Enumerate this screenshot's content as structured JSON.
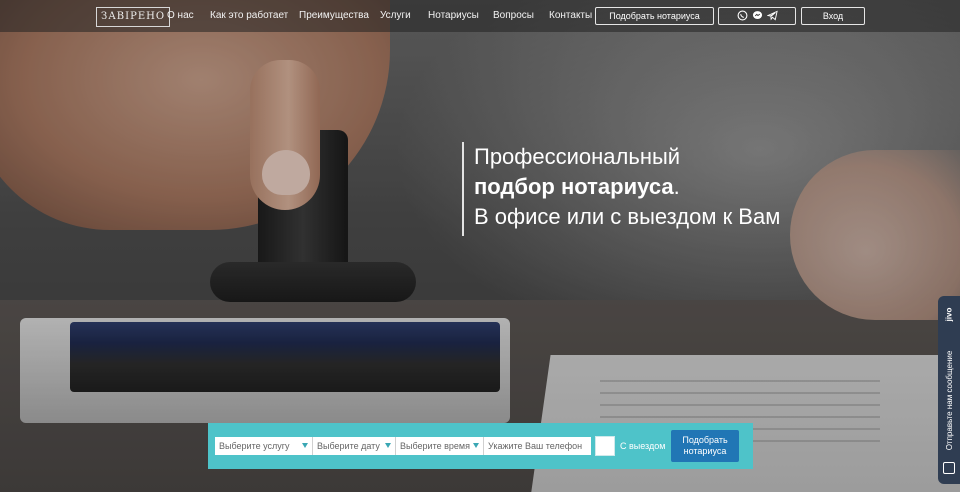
{
  "logo": "ЗАВІРЕНО",
  "nav": {
    "items": [
      {
        "label": "О нас"
      },
      {
        "label": "Как это работает"
      },
      {
        "label": "Преимущества"
      },
      {
        "label": "Услуги"
      },
      {
        "label": "Нотариусы"
      },
      {
        "label": "Вопросы"
      },
      {
        "label": "Контакты"
      }
    ],
    "cta": "Подобрать нотариуса",
    "login": "Вход",
    "messengers": [
      "viber-icon",
      "messenger-icon",
      "telegram-icon"
    ]
  },
  "hero": {
    "line1": "Профессиональный",
    "line2_bold": "подбор нотариуса",
    "line2_tail": ".",
    "line3": "В офисе или с выездом к Вам"
  },
  "search": {
    "service_placeholder": "Выберите услугу",
    "date_placeholder": "Выберите дату",
    "time_placeholder": "Выберите время",
    "phone_placeholder": "Укажите Ваш телефон",
    "visit_label": "С выездом",
    "submit_label": "Подобрать нотариуса",
    "bar_color": "#4ec3c9",
    "button_color": "#2176b5"
  },
  "chat": {
    "brand": "jivo",
    "text": "Отправьте нам сообщение"
  }
}
